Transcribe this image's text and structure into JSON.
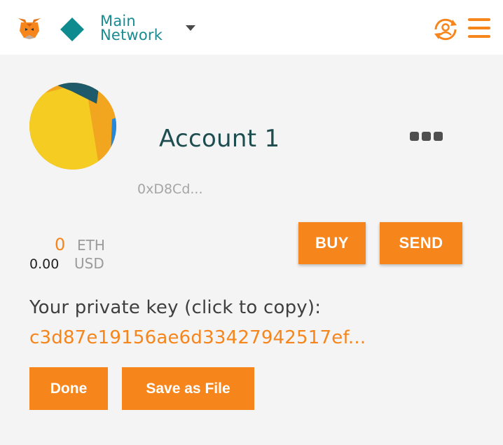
{
  "header": {
    "network": {
      "line1": "Main",
      "line2": "Network"
    },
    "icons": {
      "logo": "metamask-fox-icon",
      "network_status": "diamond-icon",
      "dropdown": "caret-down-icon",
      "account_switch": "account-sync-icon",
      "menu": "hamburger-menu-icon"
    }
  },
  "account": {
    "name": "Account 1",
    "address": "0xD8Cd...",
    "menu_icon": "more-dots-icon"
  },
  "balance": {
    "eth_value": "0",
    "eth_unit": "ETH",
    "usd_value": "0.00",
    "usd_unit": "USD"
  },
  "actions": {
    "buy_label": "BUY",
    "send_label": "SEND"
  },
  "private_key": {
    "label": "Your private key (click to copy):",
    "value": "c3d87e19156ae6d33427942517ef..."
  },
  "footer": {
    "done_label": "Done",
    "save_label": "Save as File"
  },
  "colors": {
    "accent": "#f6851b",
    "network": "#0e8b8e",
    "account_name": "#1e4d4f",
    "background": "#f4f4f4"
  }
}
